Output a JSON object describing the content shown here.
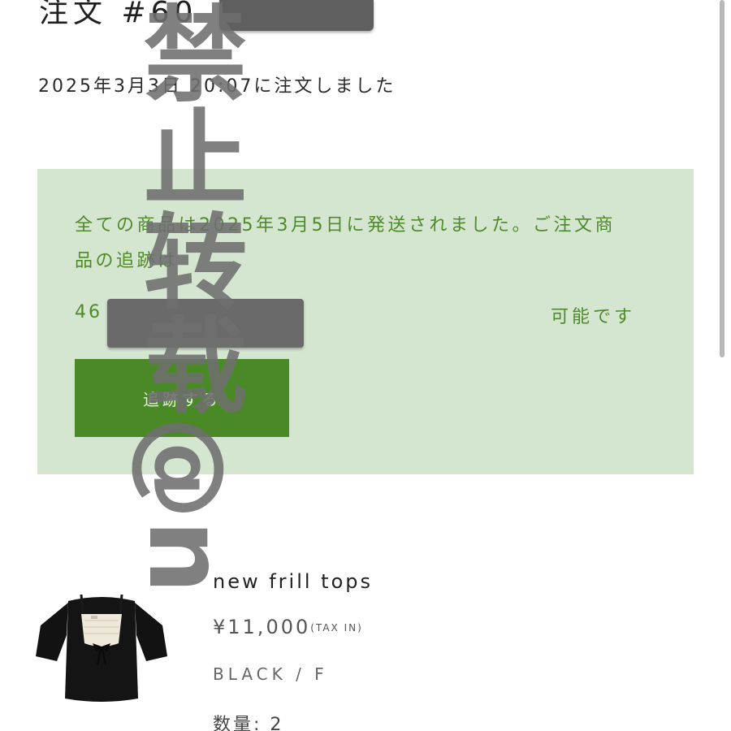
{
  "order": {
    "title": "注文 #60",
    "date_text": "2025年3月3日 20:07に注文しました"
  },
  "notice": {
    "message": "全ての商品は2025年3月5日に発送されました。ご注文商品の追跡は",
    "tracking_prefix": "46",
    "tracking_suffix": "可能です",
    "track_button_label": "追跡する"
  },
  "product": {
    "name": "new frill tops",
    "price": "¥11,000",
    "tax_note": "(TAX IN)",
    "variant": "BLACK / F",
    "quantity_text": "数量: 2"
  },
  "watermark": {
    "text": "禁止转载@n"
  },
  "colors": {
    "notice_bg": "#d5e6d0",
    "notice_text": "#4f8a2a",
    "button_bg": "#4a8a26",
    "redaction": "#5f5f5f",
    "watermark": "#6e6e6e"
  }
}
